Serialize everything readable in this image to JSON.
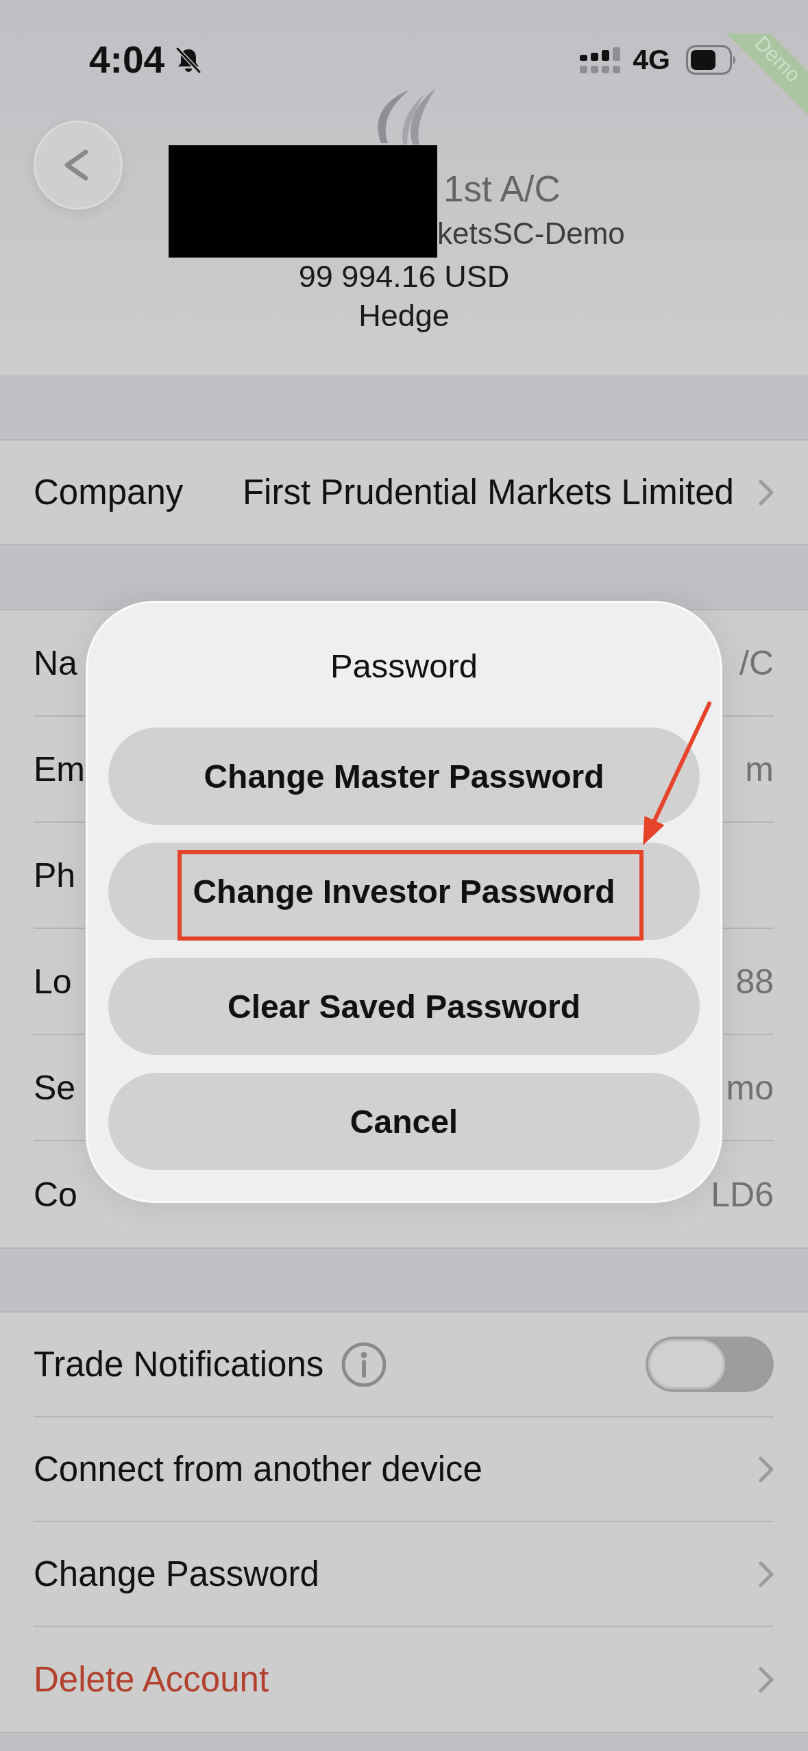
{
  "status_bar": {
    "time": "4:04",
    "network": "4G"
  },
  "demo_banner": "Demo",
  "header": {
    "redacted": true,
    "name": "1st A/C",
    "server": "ketsSC-Demo",
    "balance": "99 994.16 USD",
    "account_type": "Hedge"
  },
  "company": {
    "label": "Company",
    "value": "First Prudential Markets Limited"
  },
  "account_rows": [
    {
      "label": "Na",
      "value": "/C"
    },
    {
      "label": "Em",
      "value": "m"
    },
    {
      "label": "Ph"
    },
    {
      "label": "Lo",
      "value": "88"
    },
    {
      "label": "Se",
      "value": "mo"
    },
    {
      "label": "Co",
      "value": "LD6"
    }
  ],
  "settings_rows": [
    {
      "kind": "toggle",
      "label": "Trade Notifications",
      "on": false
    },
    {
      "kind": "link",
      "label": "Connect from another device",
      "danger": false
    },
    {
      "kind": "link",
      "label": "Change Password",
      "danger": false
    },
    {
      "kind": "link",
      "label": "Delete Account",
      "danger": true
    }
  ],
  "dialog": {
    "title": "Password",
    "buttons": [
      {
        "label": "Change Master Password",
        "highlighted": false
      },
      {
        "label": "Change Investor Password",
        "highlighted": true
      },
      {
        "label": "Clear Saved Password",
        "highlighted": false
      },
      {
        "label": "Cancel",
        "highlighted": false
      }
    ]
  }
}
